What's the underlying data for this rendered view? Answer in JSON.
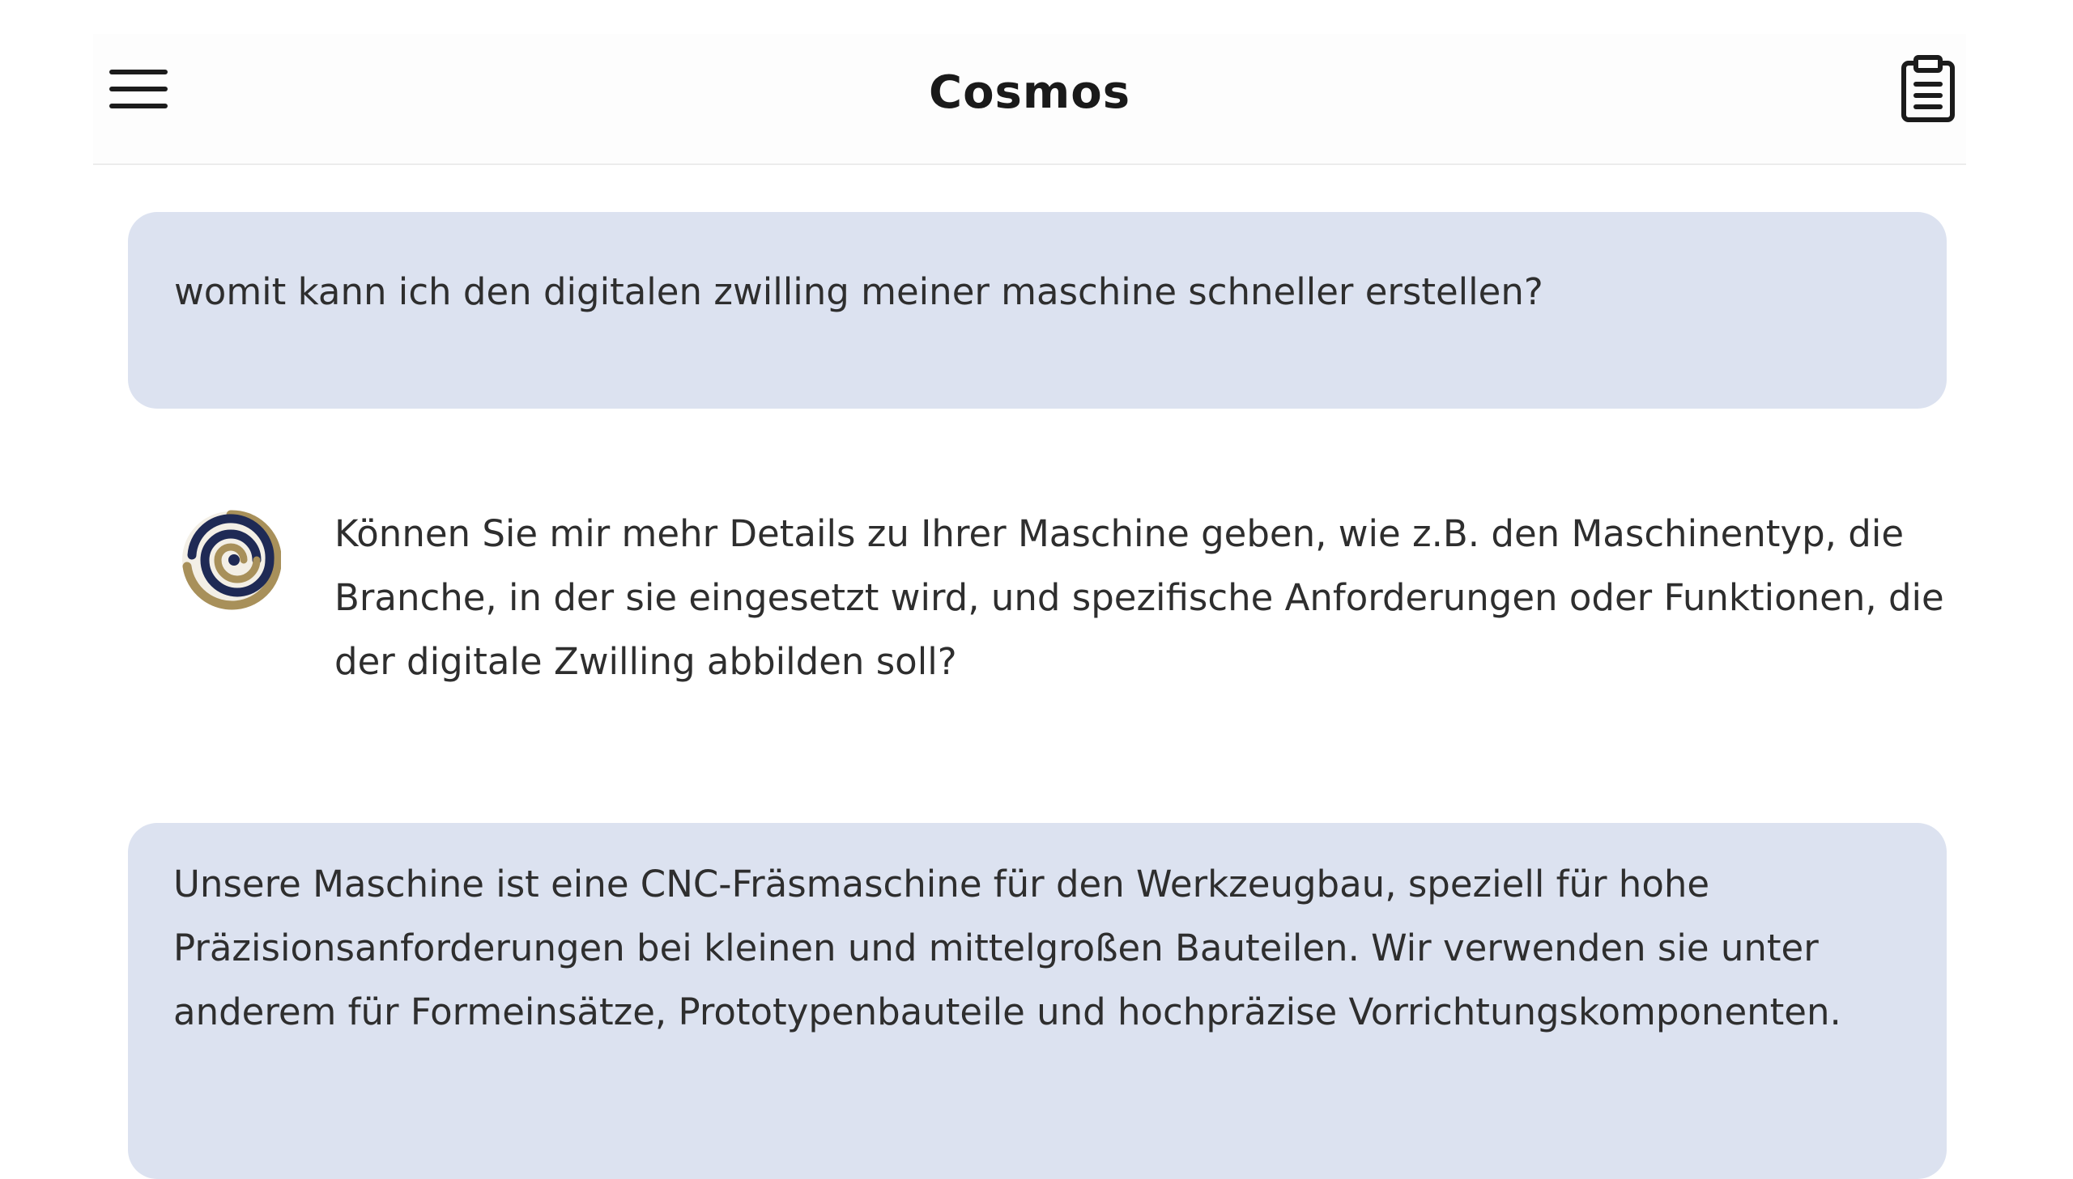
{
  "header": {
    "title": "Cosmos",
    "menu_icon": "hamburger-menu-icon",
    "action_icon": "clipboard-icon"
  },
  "messages": [
    {
      "role": "user",
      "text": "womit kann ich den digitalen zwilling meiner maschine schneller erstellen?"
    },
    {
      "role": "assistant",
      "avatar_icon": "spiral-logo-icon",
      "text": "Können Sie mir mehr Details zu Ihrer Maschine geben, wie z.B. den Maschinentyp, die Branche, in der sie eingesetzt wird, und spezifische Anforderungen oder Funktionen, die der digitale Zwilling abbilden soll?"
    },
    {
      "role": "user",
      "text": "Unsere Maschine ist eine CNC-Fräsmaschine für den Werkzeugbau, speziell für hohe Präzisionsanforderungen bei kleinen und mittelgroßen Bauteilen. Wir verwenden sie unter anderem für Formeinsätze, Prototypenbauteile und hochpräzise Vorrichtungskomponenten."
    }
  ],
  "colors": {
    "user_bubble": "#dce2f0",
    "logo_navy": "#1f2a55",
    "logo_gold": "#a8905a"
  }
}
